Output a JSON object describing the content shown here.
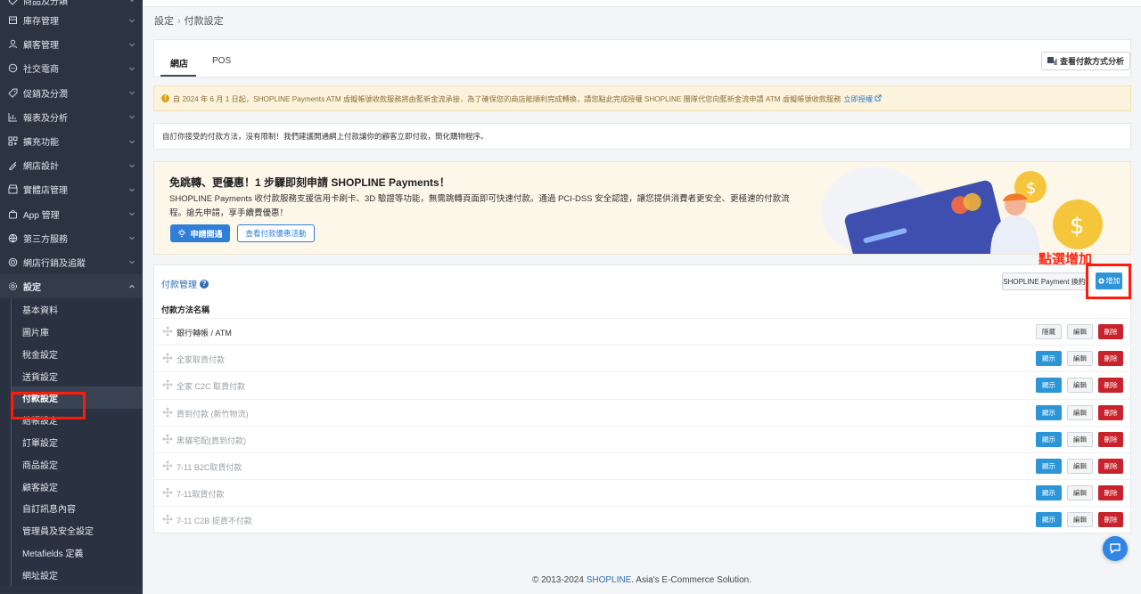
{
  "sidebar": {
    "items": [
      {
        "label": "商品及分類",
        "icon": "tag-icon"
      },
      {
        "label": "庫存管理",
        "icon": "box-icon"
      },
      {
        "label": "顧客管理",
        "icon": "user-icon"
      },
      {
        "label": "社交電商",
        "icon": "chat-icon"
      },
      {
        "label": "促銷及分潤",
        "icon": "discount-icon"
      },
      {
        "label": "報表及分析",
        "icon": "chart-icon"
      },
      {
        "label": "擴充功能",
        "icon": "grid-icon"
      },
      {
        "label": "網店設計",
        "icon": "brush-icon"
      },
      {
        "label": "實體店管理",
        "icon": "store-icon"
      },
      {
        "label": "App 管理",
        "icon": "bag-icon"
      },
      {
        "label": "第三方服務",
        "icon": "globe-icon"
      },
      {
        "label": "網店行銷及追蹤",
        "icon": "target-icon"
      },
      {
        "label": "設定",
        "icon": "gear-icon"
      }
    ],
    "sub_items": [
      "基本資料",
      "圖片庫",
      "稅金設定",
      "送貨設定",
      "付款設定",
      "結帳設定",
      "訂單設定",
      "商品設定",
      "顧客設定",
      "自訂訊息內容",
      "管理員及安全設定",
      "Metafields 定義",
      "網址設定"
    ],
    "active_sub": "付款設定"
  },
  "breadcrumb": {
    "parent": "設定",
    "separator": "›",
    "current": "付款設定"
  },
  "tabs": [
    {
      "label": "網店"
    },
    {
      "label": "POS"
    }
  ],
  "analysis_button": "查看付款方式分析",
  "notice": {
    "text": "自 2024 年 6 月 1 日起，SHOPLINE Payments ATM 虛擬帳號收款服務將由藍新金流承接，為了確保您的商店能順利完成轉換，請您點此完成授權 SHOPLINE 團隊代您向藍新金流申請 ATM 虛擬帳號收款服務",
    "link": "立即授權"
  },
  "description": "自訂你接受的付款方法，沒有限制！我們建議開通網上付款讓你的顧客立即付款，簡化購物程序。",
  "promo": {
    "title": "免跳轉、更優惠！1 步驟即刻申請 SHOPLINE Payments！",
    "body": "SHOPLINE Payments 收付款服務支援信用卡刷卡、3D 驗證等功能，無需跳轉頁面即可快速付款。通過 PCI-DSS 安全認證，讓您提供消費者更安全、更極速的付款流程。搶先申請，享手續費優惠！",
    "apply_label": "申請開通",
    "offer_label": "查看付款優惠活動"
  },
  "annotation": "點選增加",
  "payment_mgmt": {
    "title": "付款管理",
    "reorder_label": "SHOPLINE Payment 換約",
    "add_label": "增加",
    "column_header": "付款方法名稱",
    "rows": [
      {
        "name": "銀行轉帳 / ATM",
        "toggle": "隱藏",
        "edit": "編輯",
        "delete": "刪除",
        "visible": true
      },
      {
        "name": "全家取貨付款",
        "toggle": "顯示",
        "edit": "編輯",
        "delete": "刪除",
        "visible": false
      },
      {
        "name": "全家 C2C 取貨付款",
        "toggle": "顯示",
        "edit": "編輯",
        "delete": "刪除",
        "visible": false
      },
      {
        "name": "貨到付款 (新竹物流)",
        "toggle": "顯示",
        "edit": "編輯",
        "delete": "刪除",
        "visible": false
      },
      {
        "name": "黑貓宅配(貨到付款)",
        "toggle": "顯示",
        "edit": "編輯",
        "delete": "刪除",
        "visible": false
      },
      {
        "name": "7-11 B2C取貨付款",
        "toggle": "顯示",
        "edit": "編輯",
        "delete": "刪除",
        "visible": false
      },
      {
        "name": "7-11取貨付款",
        "toggle": "顯示",
        "edit": "編輯",
        "delete": "刪除",
        "visible": false
      },
      {
        "name": "7-11 C2B 提貨不付款",
        "toggle": "顯示",
        "edit": "編輯",
        "delete": "刪除",
        "visible": false
      }
    ]
  },
  "footer": {
    "prefix": "© 2013-2024 ",
    "brand": "SHOPLINE",
    "suffix": ". Asia's E-Commerce Solution."
  },
  "colors": {
    "accent": "#2c95d8",
    "danger": "#c8232c",
    "sidebar": "#2c3442",
    "annotation": "#ff1b0a"
  }
}
